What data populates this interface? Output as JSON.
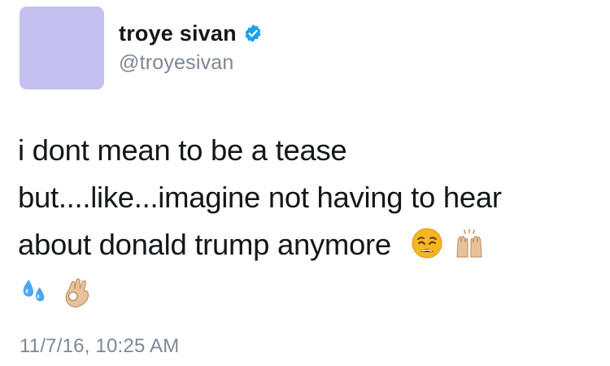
{
  "user": {
    "display_name": "troye sivan",
    "handle": "@troyesivan",
    "verified": true,
    "avatar_color": "#c4c1f1"
  },
  "tweet": {
    "line1": "i dont mean to be a tease",
    "line2": "but....like...imagine not having to hear",
    "line3": "about donald trump anymore",
    "emojis_inline": [
      "weary-face-emoji",
      "raising-hands-emoji"
    ],
    "emojis_next_line": [
      "sweat-droplets-emoji",
      "ok-hand-emoji"
    ],
    "timestamp": "11/7/16, 10:25 AM"
  },
  "colors": {
    "text": "#14171a",
    "secondary": "#7d8893",
    "verified_blue": "#1da1f2"
  }
}
